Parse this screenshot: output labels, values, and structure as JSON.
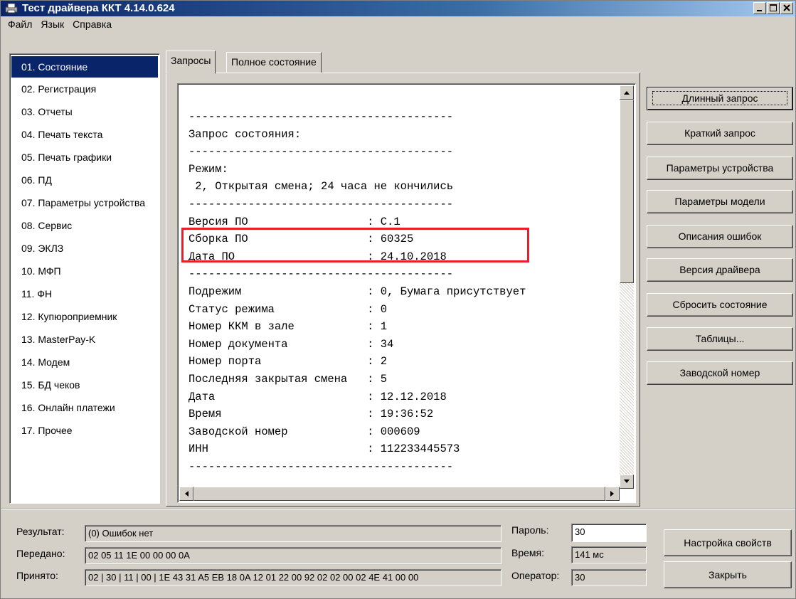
{
  "window": {
    "title": "Тест драйвера ККТ 4.14.0.624"
  },
  "menu": [
    "Файл",
    "Язык",
    "Справка"
  ],
  "sidebar": {
    "items": [
      "01. Состояние",
      "02. Регистрация",
      "03. Отчеты",
      "04. Печать текста",
      "05. Печать графики",
      "06. ПД",
      "07. Параметры устройства",
      "08. Сервис",
      "09. ЭКЛЗ",
      "10. МФП",
      "11. ФН",
      "12. Купюроприемник",
      "13. MasterPay-K",
      "14. Модем",
      "15. БД чеков",
      "16. Онлайн платежи",
      "17. Прочее"
    ],
    "active_index": 0
  },
  "tabs": [
    "Запросы",
    "Полное состояние"
  ],
  "console": {
    "lines": [
      "----------------------------------------",
      "Запрос состояния:",
      "----------------------------------------",
      "Режим:",
      " 2, Открытая смена; 24 часа не кончились",
      "----------------------------------------",
      "Версия ПО                  : C.1",
      "Сборка ПО                  : 60325",
      "Дата ПО                    : 24.10.2018",
      "----------------------------------------",
      "Подрежим                   : 0, Бумага присутствует",
      "Статус режима              : 0",
      "Номер ККМ в зале           : 1",
      "Номер документа            : 34",
      "Номер порта                : 2",
      "Последняя закрытая смена   : 5",
      "Дата                       : 12.12.2018",
      "Время                      : 19:36:52",
      "Заводской номер            : 000609",
      "ИНН                        : 112233445573",
      "----------------------------------------"
    ]
  },
  "actions": [
    "Длинный запрос",
    "Краткий запрос",
    "Параметры устройства",
    "Параметры модели",
    "Описания ошибок",
    "Версия драйвера",
    "Сбросить состояние",
    "Таблицы...",
    "Заводской номер"
  ],
  "status": {
    "result_label": "Результат:",
    "result_value": "(0) Ошибок нет",
    "sent_label": "Передано:",
    "sent_value": "02 05 11 1E 00 00 00 0A",
    "received_label": "Принято:",
    "received_value": "02 | 30 | 11 | 00 | 1E 43 31 A5 EB 18 0A 12 01 22 00 92 02 02 00 02 4E 41 00 00",
    "password_label": "Пароль:",
    "password_value": "30",
    "time_label": "Время:",
    "time_value": "141 мс",
    "operator_label": "Оператор:",
    "operator_value": "30",
    "settings_button": "Настройка свойств",
    "close_button": "Закрыть"
  }
}
